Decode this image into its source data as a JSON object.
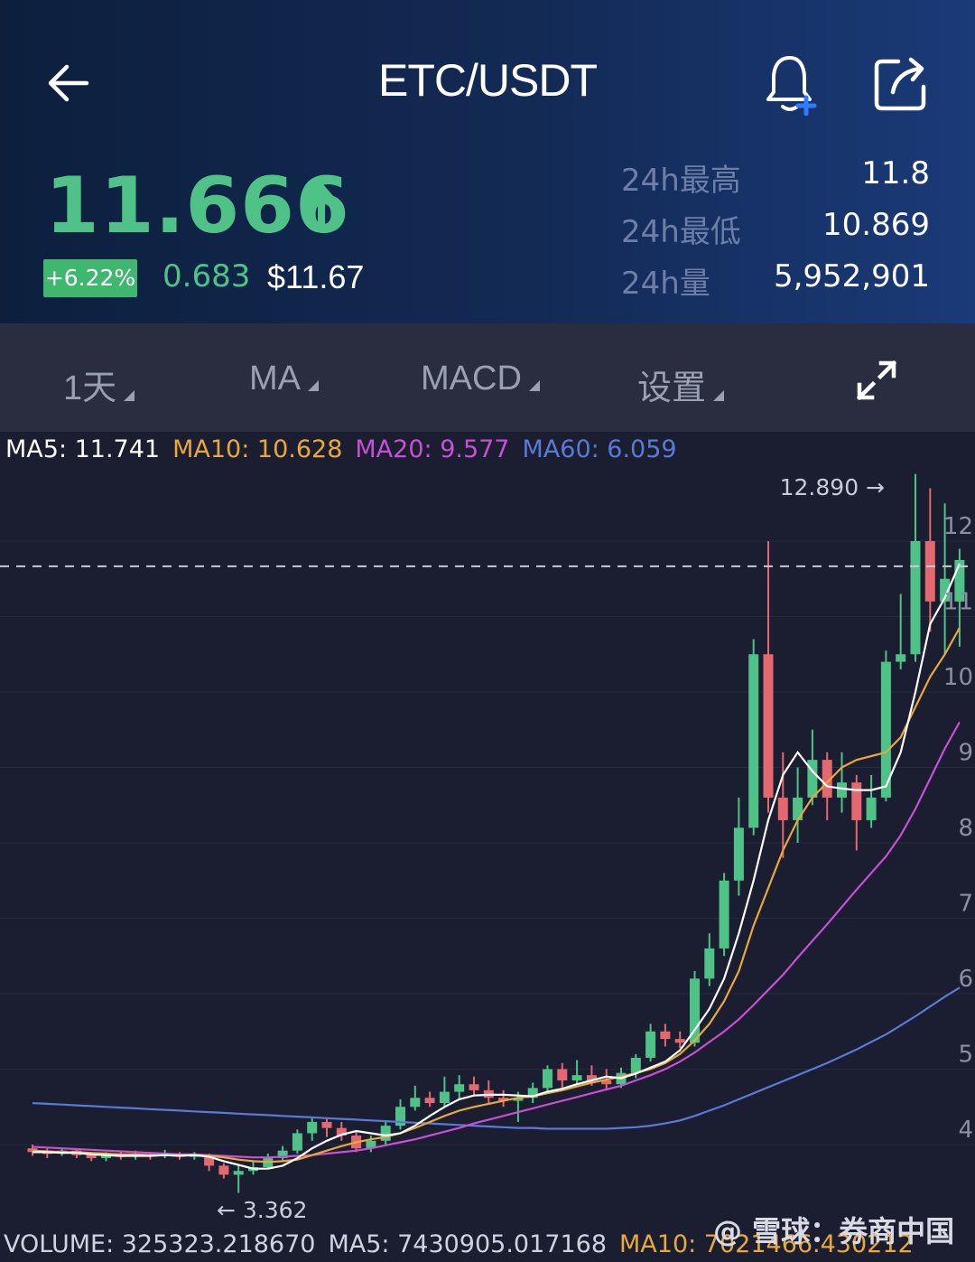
{
  "header": {
    "title": "ETC/USDT",
    "price": "11.666",
    "change_pct": "+6.22%",
    "change_abs": "0.683",
    "usd_price": "$11.67",
    "stats": [
      {
        "label": "24h最高",
        "value": "11.8"
      },
      {
        "label": "24h最低",
        "value": "10.869"
      },
      {
        "label": "24h量",
        "value": "5,952,901"
      }
    ]
  },
  "toolbar": {
    "period": "1天",
    "indicator": "MA",
    "sub_indicator": "MACD",
    "settings": "设置"
  },
  "ma_legend": {
    "ma5": "MA5: 11.741",
    "ma10": "MA10: 10.628",
    "ma20": "MA20: 9.577",
    "ma60": "MA60: 6.059"
  },
  "volume_legend": {
    "volume": "VOLUME: 325323.218670",
    "ma5": "MA5: 7430905.017168",
    "ma10": "MA10: 7021466.430212"
  },
  "colors": {
    "up": "#4fc387",
    "down": "#e46870",
    "ma5": "#ffffff",
    "ma10": "#e8a83a",
    "ma20": "#c84fd6",
    "ma60": "#5a7ad8"
  },
  "chart_data": {
    "type": "candlestick",
    "high_label": "12.890 →",
    "low_label": "← 3.362",
    "y_ticks": [
      "12",
      "11",
      "10",
      "9",
      "8",
      "7",
      "6",
      "5",
      "4"
    ],
    "current_price": 11.666,
    "candles": [
      [
        3.95,
        3.9,
        4.0,
        3.85
      ],
      [
        3.9,
        3.88,
        3.95,
        3.82
      ],
      [
        3.88,
        3.92,
        3.96,
        3.85
      ],
      [
        3.92,
        3.86,
        3.95,
        3.82
      ],
      [
        3.86,
        3.82,
        3.9,
        3.78
      ],
      [
        3.82,
        3.86,
        3.9,
        3.78
      ],
      [
        3.86,
        3.84,
        3.92,
        3.8
      ],
      [
        3.84,
        3.87,
        3.92,
        3.8
      ],
      [
        3.87,
        3.85,
        3.9,
        3.8
      ],
      [
        3.85,
        3.88,
        3.93,
        3.82
      ],
      [
        3.88,
        3.84,
        3.9,
        3.8
      ],
      [
        3.84,
        3.86,
        3.9,
        3.8
      ],
      [
        3.86,
        3.72,
        3.88,
        3.65
      ],
      [
        3.72,
        3.6,
        3.75,
        3.55
      ],
      [
        3.6,
        3.65,
        3.72,
        3.36
      ],
      [
        3.65,
        3.7,
        3.78,
        3.6
      ],
      [
        3.7,
        3.82,
        3.88,
        3.68
      ],
      [
        3.82,
        3.92,
        3.98,
        3.78
      ],
      [
        3.92,
        4.15,
        4.2,
        3.88
      ],
      [
        4.15,
        4.3,
        4.35,
        4.05
      ],
      [
        4.3,
        4.22,
        4.35,
        4.1
      ],
      [
        4.22,
        4.12,
        4.3,
        4.05
      ],
      [
        4.12,
        3.95,
        4.18,
        3.9
      ],
      [
        3.95,
        4.05,
        4.12,
        3.9
      ],
      [
        4.05,
        4.25,
        4.3,
        4.0
      ],
      [
        4.25,
        4.5,
        4.6,
        4.2
      ],
      [
        4.5,
        4.62,
        4.78,
        4.45
      ],
      [
        4.62,
        4.55,
        4.7,
        4.5
      ],
      [
        4.55,
        4.7,
        4.9,
        4.5
      ],
      [
        4.7,
        4.8,
        4.92,
        4.6
      ],
      [
        4.8,
        4.72,
        4.9,
        4.65
      ],
      [
        4.72,
        4.62,
        4.85,
        4.55
      ],
      [
        4.62,
        4.58,
        4.72,
        4.5
      ],
      [
        4.58,
        4.62,
        4.7,
        4.3
      ],
      [
        4.62,
        4.75,
        4.82,
        4.55
      ],
      [
        4.75,
        5.0,
        5.05,
        4.7
      ],
      [
        5.0,
        4.85,
        5.08,
        4.75
      ],
      [
        4.85,
        4.92,
        5.12,
        4.8
      ],
      [
        4.92,
        4.85,
        5.05,
        4.78
      ],
      [
        4.85,
        4.8,
        5.0,
        4.72
      ],
      [
        4.8,
        4.95,
        5.02,
        4.75
      ],
      [
        4.95,
        5.15,
        5.2,
        4.88
      ],
      [
        5.15,
        5.5,
        5.6,
        5.1
      ],
      [
        5.5,
        5.4,
        5.6,
        5.3
      ],
      [
        5.4,
        5.35,
        5.5,
        5.28
      ],
      [
        5.35,
        6.2,
        6.3,
        5.3
      ],
      [
        6.2,
        6.6,
        6.8,
        6.1
      ],
      [
        6.6,
        7.5,
        7.6,
        6.5
      ],
      [
        7.5,
        8.2,
        8.6,
        7.3
      ],
      [
        8.2,
        10.5,
        10.7,
        8.1
      ],
      [
        10.5,
        8.6,
        12.0,
        8.4
      ],
      [
        8.6,
        8.3,
        9.2,
        7.8
      ],
      [
        8.3,
        8.6,
        9.0,
        8.0
      ],
      [
        8.6,
        9.1,
        9.5,
        8.5
      ],
      [
        9.1,
        8.6,
        9.2,
        8.3
      ],
      [
        8.6,
        8.8,
        9.2,
        8.4
      ],
      [
        8.8,
        8.3,
        8.9,
        7.9
      ],
      [
        8.3,
        8.6,
        8.9,
        8.2
      ],
      [
        8.6,
        10.4,
        10.55,
        8.55
      ],
      [
        10.4,
        10.5,
        11.3,
        10.3
      ],
      [
        10.5,
        12.0,
        12.89,
        10.4
      ],
      [
        12.0,
        11.2,
        12.7,
        10.8
      ],
      [
        11.2,
        11.5,
        12.5,
        10.5
      ],
      [
        11.2,
        11.75,
        11.9,
        10.6
      ]
    ],
    "ma5": [
      3.9,
      3.9,
      3.89,
      3.89,
      3.87,
      3.86,
      3.85,
      3.85,
      3.85,
      3.86,
      3.85,
      3.86,
      3.84,
      3.78,
      3.73,
      3.68,
      3.68,
      3.72,
      3.82,
      3.95,
      4.05,
      4.13,
      4.18,
      4.15,
      4.12,
      4.15,
      4.25,
      4.38,
      4.5,
      4.6,
      4.65,
      4.66,
      4.66,
      4.65,
      4.64,
      4.7,
      4.74,
      4.8,
      4.85,
      4.9,
      4.88,
      4.94,
      5.02,
      5.1,
      5.25,
      5.52,
      5.8,
      6.2,
      6.8,
      7.5,
      8.3,
      8.9,
      9.2,
      8.95,
      8.75,
      8.72,
      8.7,
      8.7,
      8.75,
      9.2,
      10.0,
      10.9,
      11.25,
      11.7
    ],
    "ma10": [
      3.92,
      3.91,
      3.9,
      3.9,
      3.89,
      3.88,
      3.87,
      3.87,
      3.86,
      3.86,
      3.86,
      3.86,
      3.85,
      3.83,
      3.8,
      3.78,
      3.77,
      3.78,
      3.8,
      3.86,
      3.92,
      3.98,
      4.03,
      4.07,
      4.1,
      4.15,
      4.22,
      4.3,
      4.38,
      4.45,
      4.5,
      4.54,
      4.58,
      4.62,
      4.64,
      4.68,
      4.72,
      4.77,
      4.82,
      4.86,
      4.9,
      4.95,
      5.0,
      5.08,
      5.2,
      5.38,
      5.6,
      5.9,
      6.3,
      6.9,
      7.4,
      7.9,
      8.3,
      8.6,
      8.8,
      9.0,
      9.1,
      9.15,
      9.2,
      9.4,
      9.8,
      10.2,
      10.5,
      10.85
    ],
    "ma20": [
      3.97,
      3.96,
      3.95,
      3.94,
      3.93,
      3.92,
      3.91,
      3.9,
      3.89,
      3.88,
      3.87,
      3.87,
      3.86,
      3.85,
      3.84,
      3.83,
      3.83,
      3.84,
      3.85,
      3.86,
      3.88,
      3.9,
      3.92,
      3.95,
      3.99,
      4.03,
      4.07,
      4.12,
      4.17,
      4.22,
      4.28,
      4.33,
      4.38,
      4.43,
      4.48,
      4.53,
      4.58,
      4.63,
      4.68,
      4.73,
      4.78,
      4.85,
      4.92,
      5.0,
      5.1,
      5.22,
      5.36,
      5.5,
      5.66,
      5.85,
      6.05,
      6.25,
      6.48,
      6.7,
      6.92,
      7.15,
      7.38,
      7.6,
      7.82,
      8.1,
      8.45,
      8.85,
      9.25,
      9.6
    ],
    "ma60": [
      4.55,
      4.54,
      4.53,
      4.52,
      4.51,
      4.5,
      4.49,
      4.48,
      4.47,
      4.46,
      4.45,
      4.44,
      4.43,
      4.42,
      4.41,
      4.4,
      4.39,
      4.38,
      4.37,
      4.36,
      4.35,
      4.34,
      4.33,
      4.32,
      4.31,
      4.3,
      4.29,
      4.28,
      4.27,
      4.26,
      4.25,
      4.24,
      4.23,
      4.22,
      4.22,
      4.21,
      4.21,
      4.21,
      4.21,
      4.21,
      4.22,
      4.23,
      4.25,
      4.28,
      4.32,
      4.38,
      4.45,
      4.52,
      4.6,
      4.68,
      4.76,
      4.84,
      4.92,
      5.0,
      5.08,
      5.17,
      5.26,
      5.36,
      5.46,
      5.58,
      5.7,
      5.83,
      5.96,
      6.08
    ]
  }
}
